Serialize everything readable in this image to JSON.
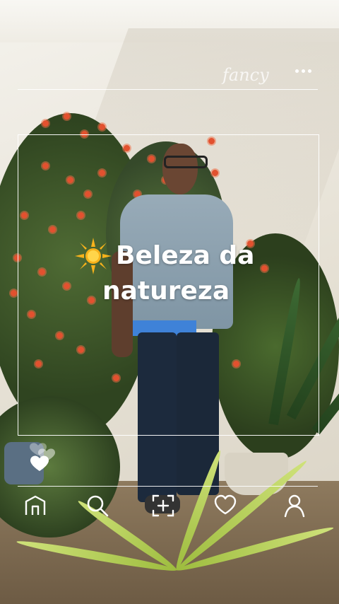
{
  "header": {
    "brand_text": "fancy",
    "more_icon": "more-horizontal-icon"
  },
  "post": {
    "caption_line1": "Beleza da",
    "caption_line2": "natureza",
    "caption_emoji": "sun-icon"
  },
  "side_actions": {
    "icons": [
      "heart-outline-icon",
      "heart-outline-icon",
      "heart-filled-icon"
    ]
  },
  "bottom_nav": {
    "items": [
      {
        "icon": "home-icon"
      },
      {
        "icon": "search-icon"
      },
      {
        "icon": "add-frame-icon"
      },
      {
        "icon": "heart-icon"
      },
      {
        "icon": "profile-icon"
      }
    ]
  },
  "colors": {
    "overlay_line": "#ffffff",
    "caption_text": "#ffffff",
    "sun": "#f7b21b"
  }
}
